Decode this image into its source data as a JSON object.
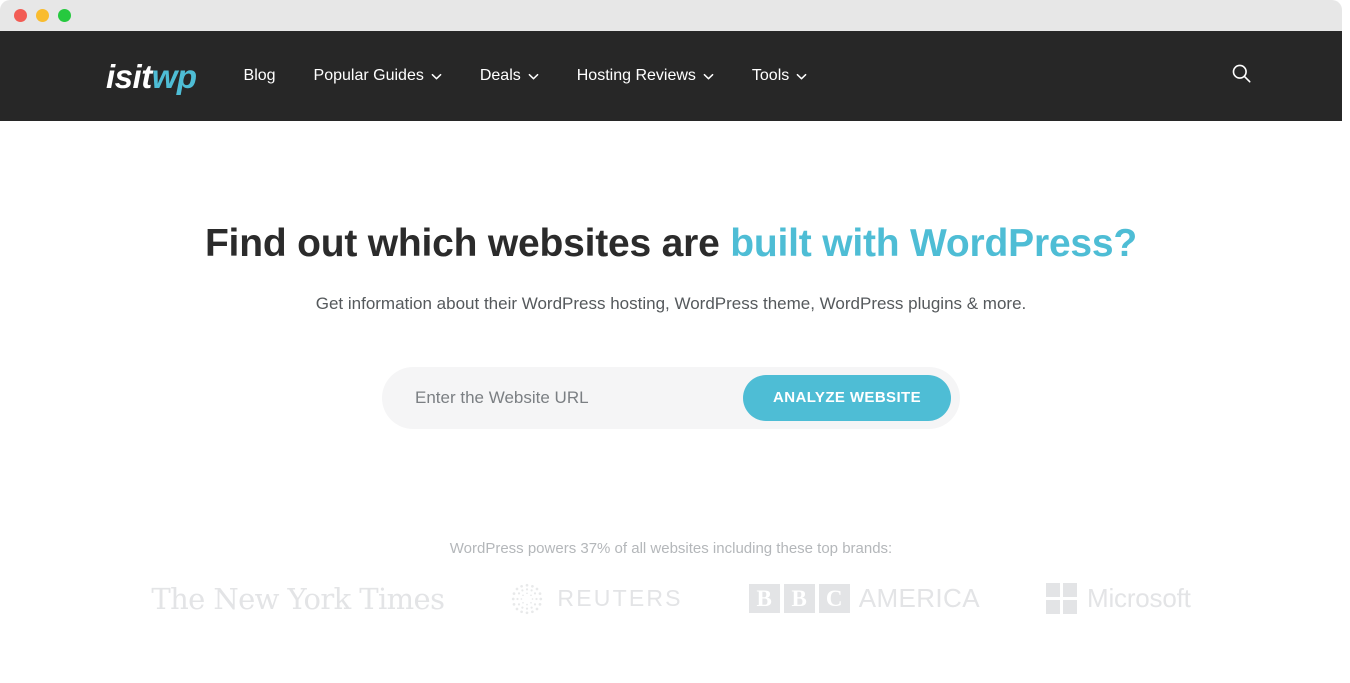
{
  "browser": {
    "traffic_lights": [
      {
        "name": "close",
        "color": "#f25c54"
      },
      {
        "name": "minimize",
        "color": "#f9bc2e"
      },
      {
        "name": "maximize",
        "color": "#26c93f"
      }
    ]
  },
  "header": {
    "background": "#272727",
    "logo": {
      "primary": "isit",
      "accent": "wp",
      "accent_color": "#4ebdd5"
    },
    "nav": [
      {
        "label": "Blog",
        "has_dropdown": false
      },
      {
        "label": "Popular Guides",
        "has_dropdown": true
      },
      {
        "label": "Deals",
        "has_dropdown": true
      },
      {
        "label": "Hosting Reviews",
        "has_dropdown": true
      },
      {
        "label": "Tools",
        "has_dropdown": true
      }
    ],
    "search_icon": "search-icon"
  },
  "hero": {
    "headline_plain": "Find out which websites are ",
    "headline_accent": "built with WordPress?",
    "accent_color": "#4ebdd5",
    "subheadline": "Get information about their WordPress hosting, WordPress theme, WordPress plugins & more."
  },
  "form": {
    "input_placeholder": "Enter the Website URL",
    "input_value": "",
    "button_label": "ANALYZE WEBSITE",
    "button_color": "#4ebdd5",
    "field_background": "#f5f5f6"
  },
  "brands": {
    "note": "WordPress powers 37% of all websites including these top brands:",
    "logos": [
      {
        "name": "the-new-york-times",
        "text": "The New York Times"
      },
      {
        "name": "reuters",
        "text": "REUTERS"
      },
      {
        "name": "bbc-america",
        "letters": [
          "B",
          "B",
          "C"
        ],
        "text": "AMERICA"
      },
      {
        "name": "microsoft",
        "text": "Microsoft"
      }
    ]
  }
}
